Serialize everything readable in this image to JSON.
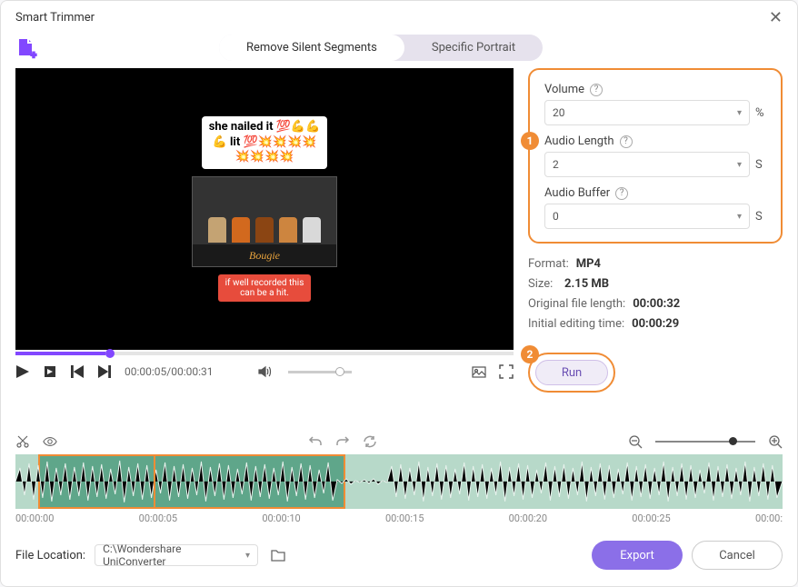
{
  "window": {
    "title": "Smart Trimmer"
  },
  "tabs": {
    "remove_silent": "Remove Silent Segments",
    "specific_portrait": "Specific Portrait"
  },
  "preview": {
    "sticker_text": "she nailed it 💯💪💪\n💪 lit 💯💥💥💥💥\n💥💥💥💥",
    "desk_brand": "Bougie",
    "caption": "if well recorded this\ncan be a hit."
  },
  "playback": {
    "current": "00:00:05",
    "duration": "00:00:31"
  },
  "panel": {
    "volume_label": "Volume",
    "volume_value": "20",
    "volume_unit": "%",
    "audio_length_label": "Audio Length",
    "audio_length_value": "2",
    "audio_length_unit": "S",
    "audio_buffer_label": "Audio Buffer",
    "audio_buffer_value": "0",
    "audio_buffer_unit": "S"
  },
  "info": {
    "format_label": "Format:",
    "format_value": "MP4",
    "size_label": "Size:",
    "size_value": "2.15 MB",
    "orig_len_label": "Original file length:",
    "orig_len_value": "00:00:32",
    "init_time_label": "Initial editing time:",
    "init_time_value": "00:00:29"
  },
  "run": {
    "label": "Run",
    "badge1": "1",
    "badge2": "2"
  },
  "ruler": {
    "t0": "00:00:00",
    "t1": "00:00:05",
    "t2": "00:00:10",
    "t3": "00:00:15",
    "t4": "00:00:20",
    "t5": "00:00:25",
    "t6": "00:00:"
  },
  "footer": {
    "file_location_label": "File Location:",
    "file_location_value": "C:\\Wondershare UniConverter",
    "export": "Export",
    "cancel": "Cancel"
  }
}
